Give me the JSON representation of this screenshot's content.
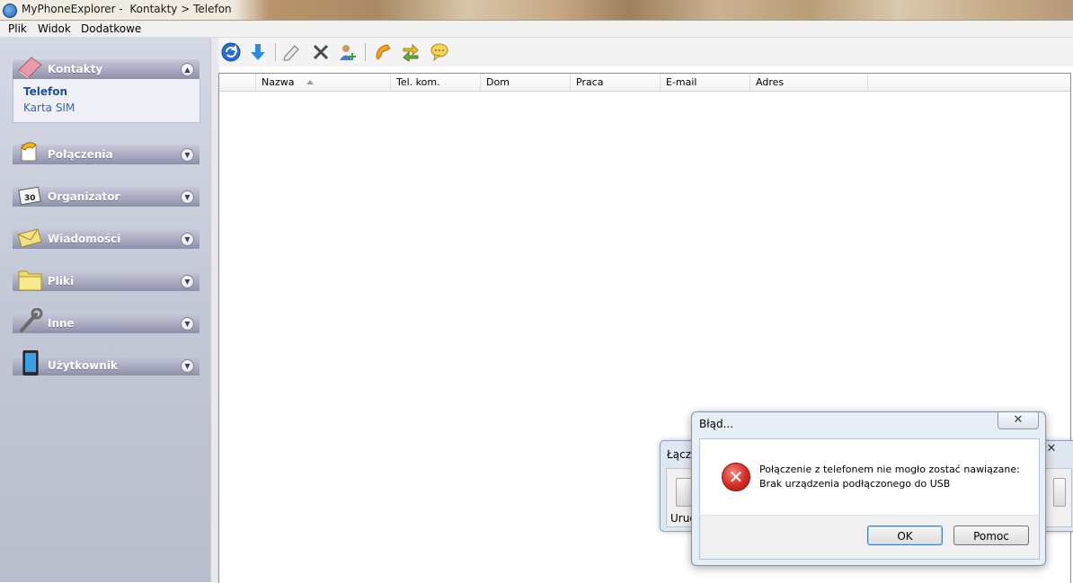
{
  "window": {
    "title": "MyPhoneExplorer -  Kontakty > Telefon"
  },
  "menu": [
    "Plik",
    "Widok",
    "Dodatkowe"
  ],
  "sidebar": {
    "sections": [
      {
        "label": "Kontakty",
        "icon": "book-icon",
        "expanded": true,
        "items": [
          {
            "label": "Telefon",
            "active": true
          },
          {
            "label": "Karta SIM",
            "active": false
          }
        ]
      },
      {
        "label": "Połączenia",
        "icon": "phone-icon",
        "expanded": false
      },
      {
        "label": "Organizator",
        "icon": "calendar-icon",
        "expanded": false
      },
      {
        "label": "Wiadomości",
        "icon": "envelope-icon",
        "expanded": false
      },
      {
        "label": "Pliki",
        "icon": "folder-icon",
        "expanded": false
      },
      {
        "label": "Inne",
        "icon": "wrench-icon",
        "expanded": false
      },
      {
        "label": "Użytkownik",
        "icon": "device-icon",
        "expanded": false
      }
    ]
  },
  "toolbar": {
    "buttons": [
      "refresh-icon",
      "download-icon",
      "edit-icon",
      "delete-icon",
      "add-contact-icon",
      "call-icon",
      "sync-icon",
      "message-icon"
    ]
  },
  "grid": {
    "columns": [
      "Nazwa",
      "Tel. kom.",
      "Dom",
      "Praca",
      "E-mail",
      "Adres"
    ],
    "sort_column": "Nazwa",
    "rows": []
  },
  "background_dialog": {
    "title": "Łącze",
    "close": "✕",
    "status": "Urud"
  },
  "error_dialog": {
    "title": "Błąd...",
    "close": "✕",
    "message_line1": "Połączenie z telefonem nie mogło zostać nawiązane:",
    "message_line2": "Brak urządzenia podłączonego do USB",
    "ok_label": "OK",
    "help_label": "Pomoc"
  },
  "colors": {
    "sidebar_header": "#a7aac0",
    "active_link": "#1f4f9e",
    "error_red": "#d22b22"
  }
}
